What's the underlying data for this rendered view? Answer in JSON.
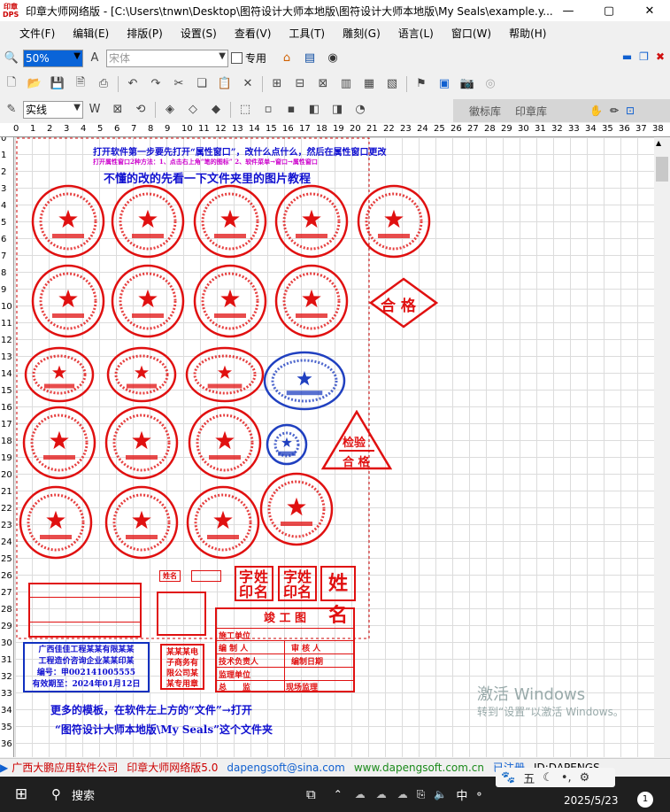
{
  "window": {
    "app_icon_text": "印章\nDPS",
    "title": "印章大师网络版 - [C:\\Users\\tnwn\\Desktop\\图符设计大师本地版\\图符设计大师本地版\\My Seals\\example.y...",
    "minimize": "—",
    "maximize": "▢",
    "close": "✕"
  },
  "menu": [
    "文件(F)",
    "编辑(E)",
    "排版(P)",
    "设置(S)",
    "查看(V)",
    "工具(T)",
    "雕刻(G)",
    "语言(L)",
    "窗口(W)",
    "帮助(H)"
  ],
  "toolbar1": {
    "zoom": "50%",
    "font": "宋体",
    "special_label": "专用"
  },
  "toolbar3": {
    "line_style": "实线"
  },
  "side_tabs": [
    "徽标库",
    "印章库"
  ],
  "ruler_top": [
    "0",
    "1",
    "2",
    "3",
    "4",
    "5",
    "6",
    "7",
    "8",
    "9",
    "10",
    "11",
    "12",
    "13",
    "14",
    "15",
    "16",
    "17",
    "18",
    "19",
    "20",
    "21",
    "22",
    "23",
    "24",
    "25",
    "26",
    "27",
    "28",
    "29",
    "30",
    "31",
    "32",
    "33",
    "34",
    "35",
    "36",
    "37",
    "38"
  ],
  "ruler_left": [
    "0",
    "1",
    "2",
    "3",
    "4",
    "5",
    "6",
    "7",
    "8",
    "9",
    "10",
    "11",
    "12",
    "13",
    "14",
    "15",
    "16",
    "17",
    "18",
    "19",
    "20",
    "21",
    "22",
    "23",
    "24",
    "25",
    "26",
    "27",
    "28",
    "29",
    "30",
    "31",
    "32",
    "33",
    "34",
    "35",
    "36"
  ],
  "canvas": {
    "header1": "打开软件第一步要先打开“属性窗口”，改什么点什么，然后在属性窗口更改",
    "header2": "打开属性窗口2种方法：1、点击右上角“笔的图标”        2、软件菜单→窗口→属性窗口",
    "header3": "不懂的改的先看一下文件夹里的图片教程",
    "hege": "合 格",
    "jianyan": "检验",
    "jianyan_hege": "合 格",
    "name_label": "姓名",
    "zi_xing_yin_ming_1": "字姓印名",
    "zi_xing_yin_ming_2": "字姓印名",
    "xing_ming": "姓名",
    "jungong_title": "竣 工 图",
    "jungong_rows": [
      "施工单位",
      "编 制 人",
      "审 核 人",
      "技术负责人",
      "编制日期",
      "监理单位",
      "总　　监",
      "现场监理"
    ],
    "cost_lines": [
      "广西佳佳工程某某有限某某",
      "工程造价咨询企业某某印某",
      "编号：甲002141005555",
      "有效期至：2024年01月12日"
    ],
    "cost_small": "某某某电子商务有限公司某某专用章",
    "footer1": "更多的模板，在软件左上方的“文件”→打开",
    "footer2": "“图符设计大师本地版\\My Seals”这个文件夹"
  },
  "watermark": {
    "line1": "激活 Windows",
    "line2": "转到“设置”以激活 Windows。"
  },
  "status": [
    "广西大鹏应用软件公司",
    "印章大师网络版5.0",
    "dapengsoft@sina.com",
    "www.dapengsoft.com.cn",
    "已注册",
    "ID:DAPENGS"
  ],
  "taskbar": {
    "search": "搜索",
    "time": "",
    "date": "2025/5/23",
    "ime": "五",
    "notification": "1"
  }
}
